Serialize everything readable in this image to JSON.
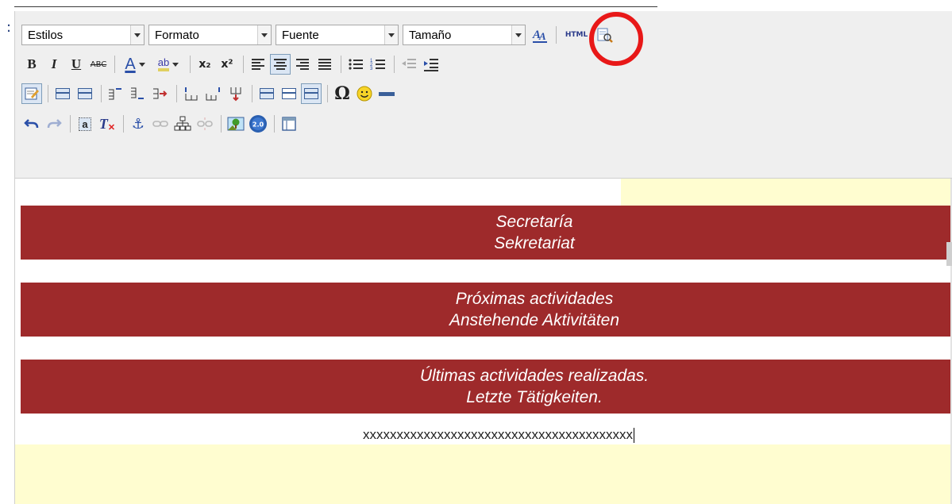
{
  "toolbar": {
    "styles_label": "Estilos",
    "format_label": "Formato",
    "font_label": "Fuente",
    "size_label": "Tamaño",
    "html_label": "HTML",
    "bold": "B",
    "italic": "I",
    "underline": "U",
    "strike": "ABC",
    "font_color": "A",
    "highlight": "ab",
    "subscript": "x₂",
    "superscript": "x²",
    "special_char": "Ω",
    "smiley": "☺",
    "anchor": "⚓",
    "remove_format": "T",
    "select_all": "a",
    "active_buttons": [
      "align-center",
      "source-edit",
      "table-props"
    ]
  },
  "content": {
    "banners": [
      {
        "line1": "Secretaría",
        "line2": "Sekretariat"
      },
      {
        "line1": "Próximas actividades",
        "line2": "Anstehende Aktivitäten"
      },
      {
        "line1": "Últimas actividades realizadas.",
        "line2": "Letzte Tätigkeiten."
      }
    ],
    "text_line": "xxxxxxxxxxxxxxxxxxxxxxxxxxxxxxxxxxxxxxxx"
  },
  "colors": {
    "banner": "#9e2a2b",
    "highlight_bg": "#fffdd0",
    "toolbar_bg": "#efefef",
    "annotation_circle": "#e81818"
  }
}
